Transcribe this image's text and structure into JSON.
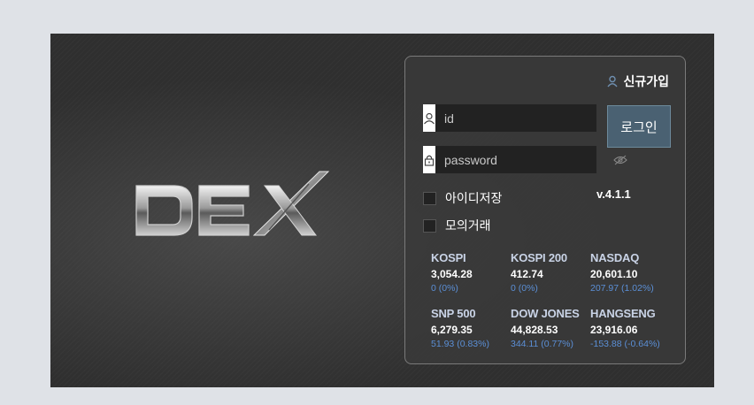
{
  "logo": {
    "text": "DEX"
  },
  "login": {
    "signup_label": "신규가입",
    "id_placeholder": "id",
    "password_placeholder": "password",
    "login_button": "로그인",
    "save_id_label": "아이디저장",
    "mock_trade_label": "모의거래",
    "version": "v.4.1.1"
  },
  "indices": [
    {
      "name": "KOSPI",
      "value": "3,054.28",
      "change": "0 (0%)"
    },
    {
      "name": "KOSPI 200",
      "value": "412.74",
      "change": "0 (0%)"
    },
    {
      "name": "NASDAQ",
      "value": "20,601.10",
      "change": "207.97 (1.02%)"
    },
    {
      "name": "SNP 500",
      "value": "6,279.35",
      "change": "51.93 (0.83%)"
    },
    {
      "name": "DOW JONES",
      "value": "44,828.53",
      "change": "344.11 (0.77%)"
    },
    {
      "name": "HANGSENG",
      "value": "23,916.06",
      "change": "-153.88 (-0.64%)"
    }
  ],
  "icons": [
    "user-icon",
    "lock-icon",
    "eye-off-icon",
    "signup-user-icon"
  ],
  "colors": {
    "accent": "#4a6172",
    "change_text": "#5b8fd6",
    "index_name": "#c9d3e6"
  }
}
